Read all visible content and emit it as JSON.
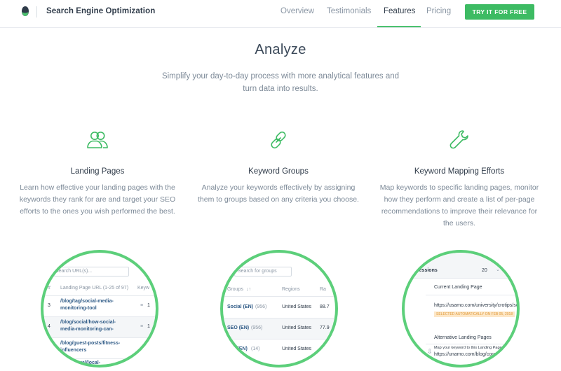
{
  "header": {
    "brand": "Search Engine Optimization",
    "nav": [
      "Overview",
      "Testimonials",
      "Features",
      "Pricing"
    ],
    "active": "Features",
    "cta": "TRY IT FOR FREE"
  },
  "hero": {
    "title": "Analyze",
    "subtitle": "Simplify your day-to-day process with more analytical features and turn data into results."
  },
  "features": [
    {
      "icon": "users-icon",
      "title": "Landing Pages",
      "text": "Learn how effective your landing pages with the keywords they rank for are and target your SEO efforts to the ones you wish performed the best."
    },
    {
      "icon": "link-icon",
      "title": "Keyword Groups",
      "text": "Analyze your keywords effectively by assigning them to groups based on any criteria you choose."
    },
    {
      "icon": "wrench-icon",
      "title": "Keyword Mapping Efforts",
      "text": "Map keywords to specific landing pages, monitor how they perform and create a list of per-page recommendations to improve their relevance for the users."
    }
  ],
  "preview1": {
    "search_placeholder": "Search URL(s)...",
    "col_hash": "#",
    "col_url": "Landing Page URL (1-25 of 97)",
    "col_kw": "Keyw",
    "rows": [
      {
        "n": "3",
        "url1": "/blog/tag/social-media-",
        "url2": "monitoring-tool",
        "v": "1"
      },
      {
        "n": "4",
        "url1": "/blog/social/how-social-",
        "url2": "media-monitoring-can-",
        "v": "1"
      },
      {
        "n": "",
        "url1": "/blog/guest-posts/fitness-",
        "url2": "influencers",
        "v": ""
      },
      {
        "n": "",
        "url1": "/general/local-",
        "url2": "",
        "v": ""
      }
    ]
  },
  "preview2": {
    "search_placeholder": "Search for groups",
    "col_groups": "Groups",
    "col_regions": "Regions",
    "col_r": "Ra",
    "rows": [
      {
        "name": "Social (EN)",
        "count": "(956)",
        "region": "United States",
        "val": "88.7"
      },
      {
        "name": "SEO (EN)",
        "count": "(956)",
        "region": "United States",
        "val": "77.9"
      },
      {
        "name": "eral (EN)",
        "count": "(14)",
        "region": "United States",
        "val": ""
      }
    ]
  },
  "preview3": {
    "sessions_label": "Sessions",
    "sessions_value": "20",
    "current_label": "Current Landing Page",
    "current_url": "https://usamo.com/university/crotips/se",
    "badge": "SELECTED AUTOMATICALLY ON FEB 05, 2018",
    "alt_label": "Alternative Landing Pages",
    "map_label": "Map your keyword to this Landing Page",
    "alt_url": "https://unamo.com/blog/conve"
  }
}
